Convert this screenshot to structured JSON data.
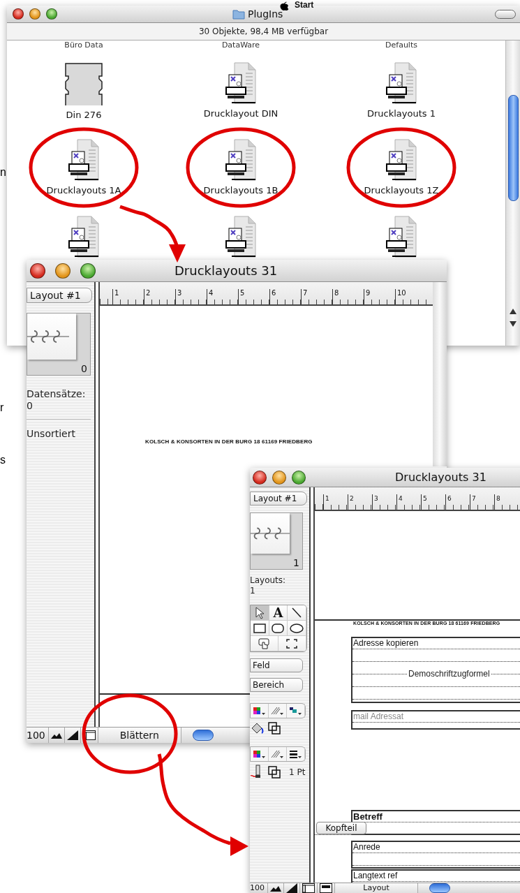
{
  "backdrop": {
    "heading": "Start",
    "side_letters": [
      "n",
      "r",
      "s"
    ]
  },
  "finder": {
    "title": "PlugIns",
    "status": "30 Objekte, 98,4 MB verfügbar",
    "items": [
      {
        "kind": "label",
        "label": "Büro Data",
        "circled": false
      },
      {
        "kind": "label",
        "label": "DataWare",
        "circled": false
      },
      {
        "kind": "label",
        "label": "Defaults",
        "circled": false
      },
      {
        "kind": "plugin",
        "label": "Din 276",
        "circled": false
      },
      {
        "kind": "document",
        "label": "Drucklayout DIN",
        "circled": false
      },
      {
        "kind": "document",
        "label": "Drucklayouts 1",
        "circled": false
      },
      {
        "kind": "document",
        "label": "Drucklayouts 1A",
        "circled": true
      },
      {
        "kind": "document",
        "label": "Drucklayouts 1B",
        "circled": true
      },
      {
        "kind": "document",
        "label": "Drucklayouts 1Z",
        "circled": true
      },
      {
        "kind": "document",
        "circled": false
      },
      {
        "kind": "document",
        "circled": false
      },
      {
        "kind": "document",
        "circled": false
      }
    ]
  },
  "browse_window": {
    "title": "Drucklayouts 31",
    "layout_menu": "Layout #1",
    "book_count": "0",
    "records_label": "Datensätze:",
    "records_value": "0",
    "sort_status": "Unsortiert",
    "ruler": [
      "1",
      "2",
      "3",
      "4",
      "5",
      "6",
      "7",
      "8",
      "9",
      "10"
    ],
    "letterhead": "KOLSCH & KONSORTEN  IN DER BURG 18  61169 FRIEDBERG",
    "zoom": "100",
    "mode": {
      "label": "Blättern",
      "circled": true
    }
  },
  "layout_window": {
    "title": "Drucklayouts 31",
    "layout_menu": "Layout #1",
    "book_count": "1",
    "layouts_label": "Layouts:",
    "layouts_value": "1",
    "tools": [
      {
        "kind": "pointer",
        "selected": true
      },
      {
        "kind": "text",
        "glyph": "A",
        "selected": false
      },
      {
        "kind": "line",
        "selected": false
      },
      {
        "kind": "rect",
        "selected": false
      },
      {
        "kind": "rounded-rect",
        "selected": false
      },
      {
        "kind": "oval",
        "selected": false
      },
      {
        "kind": "button",
        "selected": false
      },
      {
        "kind": "field-frame",
        "selected": false
      }
    ],
    "field_menu": "Feld",
    "part_menu": "Bereich",
    "line_width": "1 Pt",
    "ruler": [
      "1",
      "2",
      "3",
      "4",
      "5",
      "6",
      "7",
      "8"
    ],
    "letterhead": "KOLSCH & KONSORTEN  IN DER BURG 18  61169 FRIEDBERG",
    "objects": [
      {
        "kind": "address",
        "text": "Adresse kopieren",
        "overlay_text": "Demoschriftzugformel"
      },
      {
        "kind": "field",
        "text": "mail Adressat"
      },
      {
        "kind": "subject",
        "text": "Betreff"
      },
      {
        "kind": "salutation",
        "text": "Anrede"
      },
      {
        "kind": "body",
        "text": "Langtext ref"
      }
    ],
    "part_label": "Kopfteil",
    "zoom": "100",
    "mode": {
      "label": "Layout",
      "circled": false
    }
  }
}
